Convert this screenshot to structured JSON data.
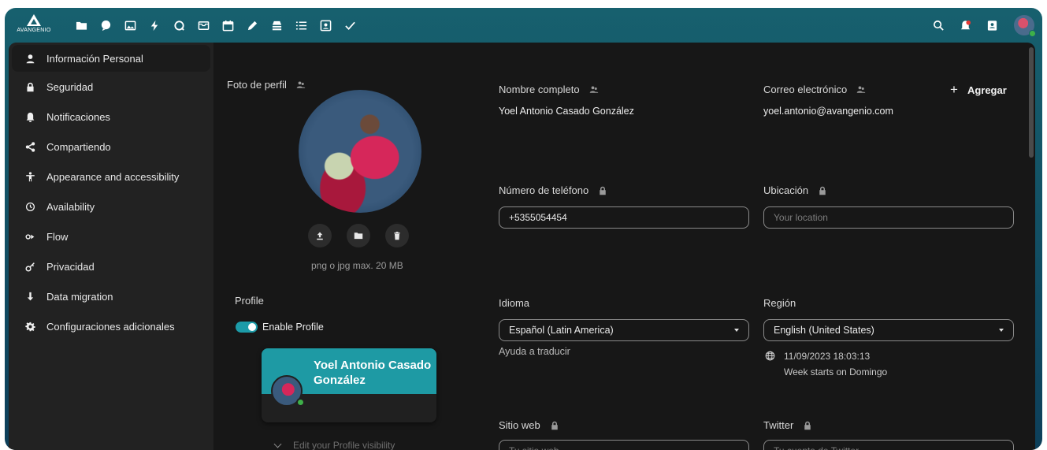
{
  "app": {
    "logo_text": "AVANGENIO",
    "apps": [
      "files-icon",
      "talk-icon",
      "photos-icon",
      "activity-icon",
      "search-app-icon",
      "mail-icon",
      "calendar-icon",
      "notes-icon",
      "deck-icon",
      "tasks-icon",
      "contacts-icon",
      "check-icon"
    ],
    "right": [
      "search-icon",
      "notifications-icon",
      "contacts-menu-icon",
      "user-avatar"
    ]
  },
  "sidebar": {
    "items": [
      {
        "label": "Información Personal",
        "icon": "user-icon"
      },
      {
        "label": "Seguridad",
        "icon": "lock-icon"
      },
      {
        "label": "Notificaciones",
        "icon": "bell-icon"
      },
      {
        "label": "Compartiendo",
        "icon": "share-icon"
      },
      {
        "label": "Appearance and accessibility",
        "icon": "accessibility-icon"
      },
      {
        "label": "Availability",
        "icon": "clock-icon"
      },
      {
        "label": "Flow",
        "icon": "flow-icon"
      },
      {
        "label": "Privacidad",
        "icon": "key-icon"
      },
      {
        "label": "Data migration",
        "icon": "download-icon"
      },
      {
        "label": "Configuraciones adicionales",
        "icon": "gear-icon"
      }
    ]
  },
  "profile_photo": {
    "label": "Foto de perfil",
    "hint": "png o jpg max. 20 MB"
  },
  "profile": {
    "section_label": "Profile",
    "enable_label": "Enable Profile",
    "enabled": true,
    "card_name": "Yoel Antonio Casado González",
    "visibility_label": "Edit your Profile visibility"
  },
  "fields": {
    "full_name": {
      "label": "Nombre completo",
      "value": "Yoel Antonio Casado González"
    },
    "email": {
      "label": "Correo electrónico",
      "value": "yoel.antonio@avangenio.com",
      "add_label": "Agregar"
    },
    "phone": {
      "label": "Número de teléfono",
      "value": "+5355054454"
    },
    "location": {
      "label": "Ubicación",
      "placeholder": "Your location"
    },
    "language": {
      "label": "Idioma",
      "value": "Español (Latin America)",
      "help": "Ayuda a traducir"
    },
    "region": {
      "label": "Región",
      "value": "English (United States)",
      "datetime": "11/09/2023 18:03:13",
      "week_start": "Week starts on Domingo"
    },
    "website": {
      "label": "Sitio web",
      "placeholder": "Tu sitio web"
    },
    "twitter": {
      "label": "Twitter",
      "placeholder": "Tu cuenta de Twitter"
    }
  },
  "colors": {
    "header": "#17606e",
    "accent": "#1e9aa4",
    "background": "#171717",
    "sidebar": "#222222",
    "online": "#3eb049"
  }
}
